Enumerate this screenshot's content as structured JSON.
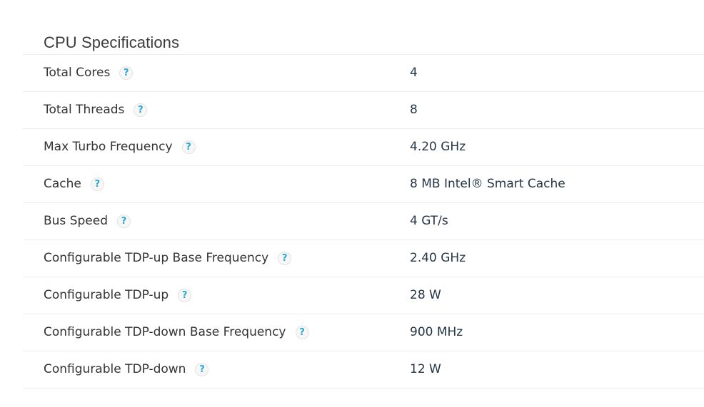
{
  "section": {
    "title": "CPU Specifications",
    "help_icon_glyph": "?",
    "colors": {
      "help_icon": "#2ba7d6",
      "value_text": "#253746",
      "label_text": "#333333",
      "divider": "#ececec"
    }
  },
  "specs": [
    {
      "label": "Total Cores",
      "value": "4"
    },
    {
      "label": "Total Threads",
      "value": "8"
    },
    {
      "label": "Max Turbo Frequency",
      "value": "4.20 GHz"
    },
    {
      "label": "Cache",
      "value": "8 MB Intel® Smart Cache"
    },
    {
      "label": "Bus Speed",
      "value": "4 GT/s"
    },
    {
      "label": "Configurable TDP-up Base Frequency",
      "value": "2.40 GHz"
    },
    {
      "label": "Configurable TDP-up",
      "value": "28 W"
    },
    {
      "label": "Configurable TDP-down Base Frequency",
      "value": "900 MHz"
    },
    {
      "label": "Configurable TDP-down",
      "value": "12 W"
    }
  ]
}
